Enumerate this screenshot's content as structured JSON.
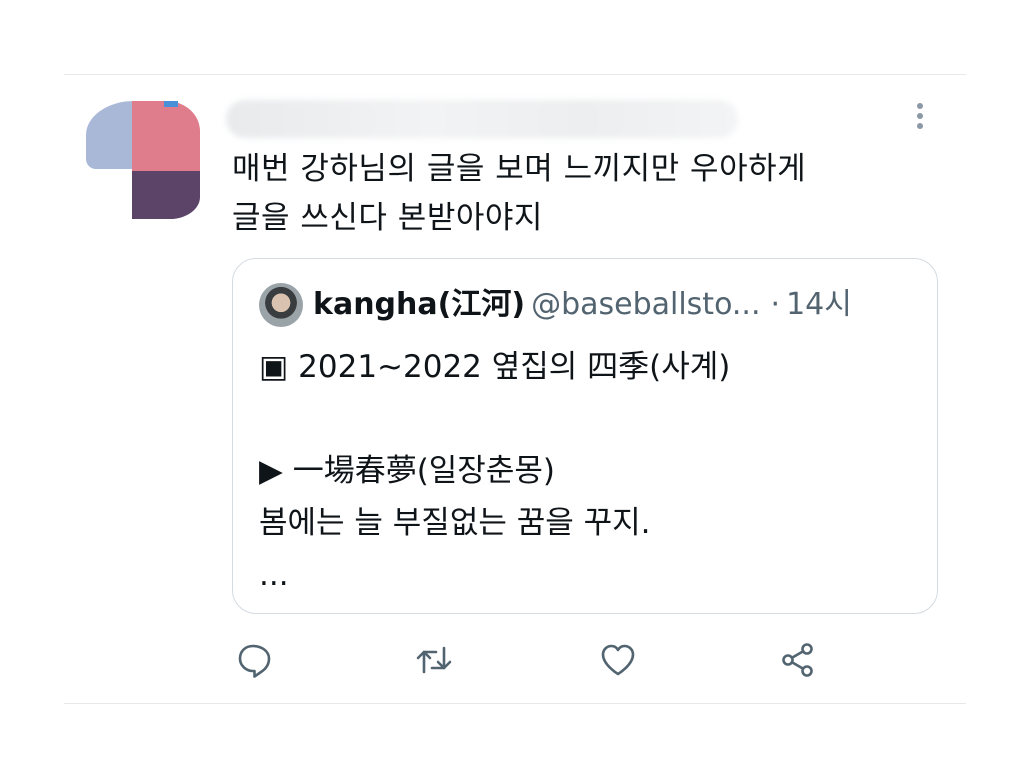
{
  "tweet": {
    "text_line1": "매번 강하님의 글을 보며 느끼지만 우아하게",
    "text_line2": "글을 쓰신다 본받아야지"
  },
  "quote": {
    "author": "kangha(江河)",
    "handle": "@baseballsto...",
    "separator": "·",
    "time": "14시",
    "body": "▣ 2021~2022 옆집의 四季(사계)\n\n▶ 一場春夢(일장춘몽)\n봄에는 늘 부질없는 꿈을 꾸지.\n..."
  },
  "actions": [
    "reply-icon",
    "retweet-icon",
    "like-icon",
    "share-icon"
  ],
  "colors": {
    "text": "#0f1419",
    "secondary": "#536471",
    "border": "#d4dbe1",
    "divider": "#e6e9ec"
  }
}
